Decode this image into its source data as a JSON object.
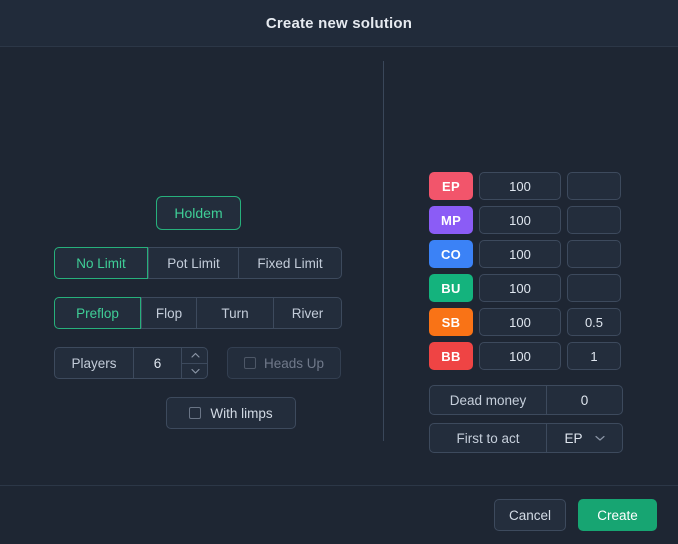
{
  "header": {
    "title": "Create new solution"
  },
  "game": {
    "label": "Holdem"
  },
  "limit": {
    "options": [
      {
        "label": "No Limit",
        "selected": true
      },
      {
        "label": "Pot Limit",
        "selected": false
      },
      {
        "label": "Fixed Limit",
        "selected": false
      }
    ]
  },
  "street": {
    "options": [
      {
        "label": "Preflop",
        "selected": true
      },
      {
        "label": "Flop",
        "selected": false
      },
      {
        "label": "Turn",
        "selected": false
      },
      {
        "label": "River",
        "selected": false
      }
    ]
  },
  "players": {
    "label": "Players",
    "value": "6"
  },
  "heads_up": {
    "label": "Heads Up",
    "checked": false,
    "disabled": true
  },
  "with_limps": {
    "label": "With limps",
    "checked": false
  },
  "positions": [
    {
      "name": "EP",
      "color": "#f2556b",
      "stack": "100",
      "blind": ""
    },
    {
      "name": "MP",
      "color": "#8b5cf6",
      "stack": "100",
      "blind": ""
    },
    {
      "name": "CO",
      "color": "#3b82f6",
      "stack": "100",
      "blind": ""
    },
    {
      "name": "BU",
      "color": "#14b37d",
      "stack": "100",
      "blind": ""
    },
    {
      "name": "SB",
      "color": "#f97316",
      "stack": "100",
      "blind": "0.5"
    },
    {
      "name": "BB",
      "color": "#ef4444",
      "stack": "100",
      "blind": "1"
    }
  ],
  "dead_money": {
    "label": "Dead money",
    "value": "0"
  },
  "first_to_act": {
    "label": "First to act",
    "value": "EP"
  },
  "footer": {
    "cancel_label": "Cancel",
    "create_label": "Create"
  },
  "colors": {
    "background": "#1e2633",
    "header_background": "#212b3a",
    "accent": "#27b07c",
    "accent_text": "#3fcf97",
    "create_button": "#17a572",
    "border": "#3d4a5d"
  }
}
